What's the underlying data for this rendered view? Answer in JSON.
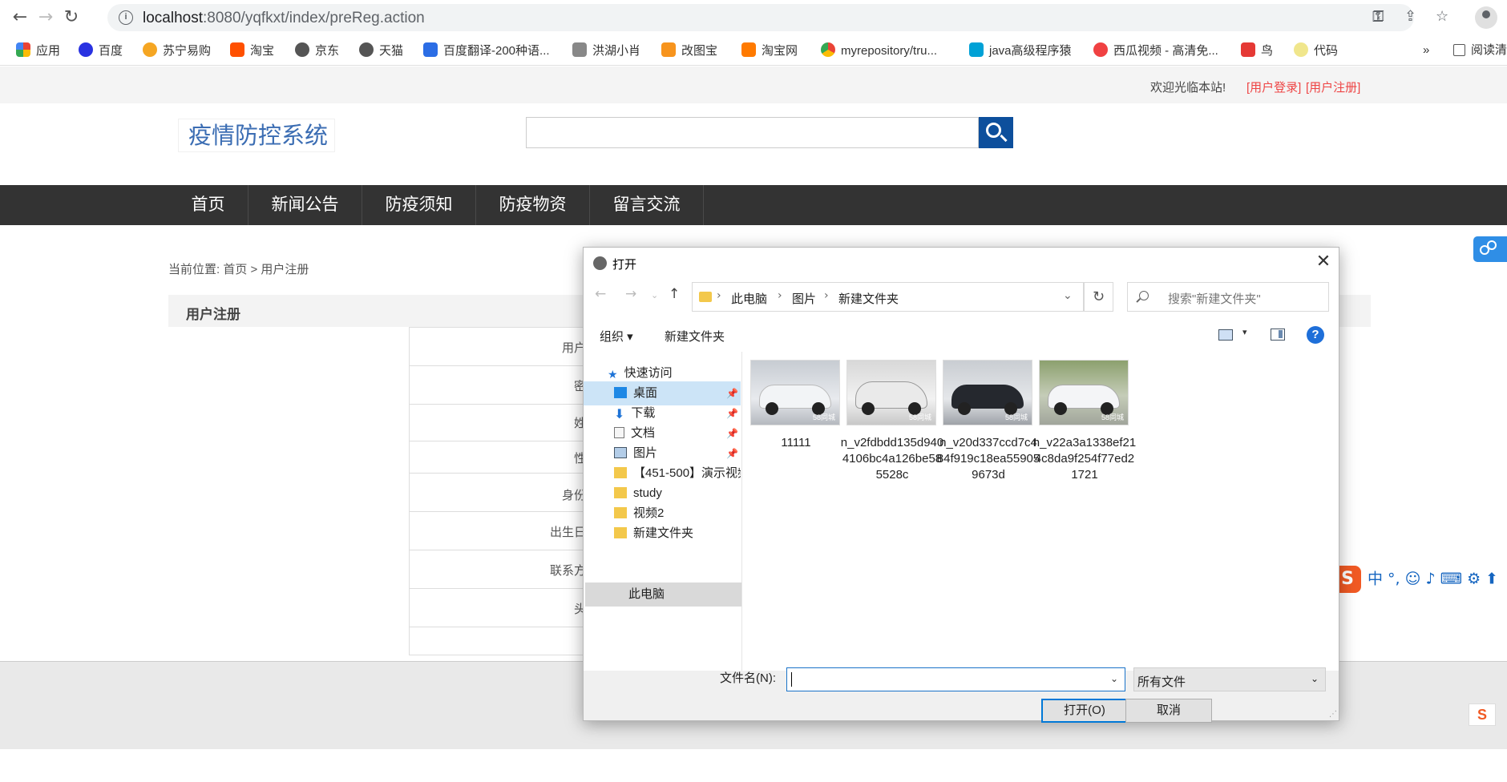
{
  "browser": {
    "url_host": "localhost",
    "url_path": ":8080/yqfkxt/index/preReg.action",
    "bookmarks": [
      "应用",
      "百度",
      "苏宁易购",
      "淘宝",
      "京东",
      "天猫",
      "百度翻译-200种语...",
      "洪湖小肖",
      "改图宝",
      "淘宝网",
      "myrepository/tru...",
      "java高级程序猿",
      "西瓜视频 - 高清免...",
      "鸟",
      "代码"
    ],
    "more": "»",
    "reading_list": "阅读清"
  },
  "site": {
    "welcome": "欢迎光临本站!",
    "login_link": "[用户登录]",
    "register_link": "[用户注册]",
    "logo_text": "疫情防控系统",
    "nav": [
      "首页",
      "新闻公告",
      "防疫须知",
      "防疫物资",
      "留言交流"
    ],
    "breadcrumb": "当前位置: 首页 > 用户注册",
    "section_title": "用户注册",
    "form_labels": [
      "用户",
      "密",
      "姓",
      "性",
      "身份",
      "出生日",
      "联系方",
      "头"
    ]
  },
  "dialog": {
    "title": "打开",
    "close": "✕",
    "path": [
      "此电脑",
      "图片",
      "新建文件夹"
    ],
    "search_placeholder": "搜索\"新建文件夹\"",
    "organize": "组织 ▾",
    "new_folder": "新建文件夹",
    "help": "?",
    "tree": {
      "quick_access": "快速访问",
      "items": [
        "桌面",
        "下载",
        "文档",
        "图片",
        "【451-500】演示视频",
        "study",
        "视频2",
        "新建文件夹"
      ],
      "this_pc": "此电脑"
    },
    "files": [
      {
        "name": "11111",
        "color": "#e8ebee"
      },
      {
        "name": "n_v2fdbdd135d9404106bc4a126be585528c",
        "color": "#e4e6e8"
      },
      {
        "name": "n_v20d337ccd7c484f919c18ea559059673d",
        "color": "#2a2d33"
      },
      {
        "name": "n_v22a3a1338ef214c8da9f254f77ed21721",
        "color": "#eef0f2"
      }
    ],
    "watermark": "58同城",
    "filename_label": "文件名(N):",
    "filename_value": "",
    "filter": "所有文件",
    "open_button": "打开(O)",
    "cancel_button": "取消"
  },
  "ime": {
    "logo": "S",
    "text": "中 °, ☺ ♪ ⌨ ⚙ ⬆"
  }
}
